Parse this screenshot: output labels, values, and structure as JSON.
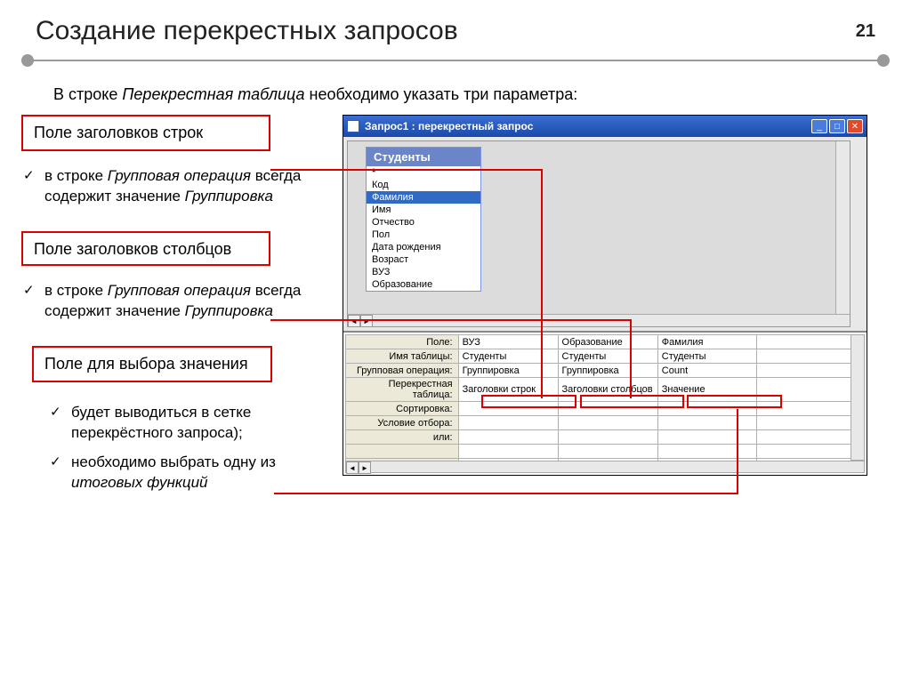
{
  "slide": {
    "title": "Создание перекрестных запросов",
    "number": "21"
  },
  "intro": {
    "prefix": "В строке ",
    "em": "Перекрестная таблица",
    "suffix": " необходимо указать три параметра:"
  },
  "labels": {
    "rowHeaders": "Поле заголовков строк",
    "colHeaders": "Поле заголовков столбцов",
    "valueField": "Поле для выбора значения"
  },
  "bullets": {
    "b1_prefix": "в строке ",
    "b1_em": "Групповая операция",
    "b1_mid": " всегда содержит значение ",
    "b1_em2": "Группировка",
    "b2_prefix": "в строке ",
    "b2_em": "Групповая операция",
    "b2_mid": " всегда содержит значение ",
    "b2_em2": "Группировка",
    "b3": "будет выводиться в сетке перекрёстного запроса);",
    "b4_prefix": "необходимо выбрать одну из ",
    "b4_em": "итоговых функций"
  },
  "window": {
    "title": "Запрос1 : перекрестный запрос",
    "tableName": "Студенты",
    "fields": [
      "Код",
      "Фамилия",
      "Имя",
      "Отчество",
      "Пол",
      "Дата рождения",
      "Возраст",
      "ВУЗ",
      "Образование"
    ],
    "selectedField": "Фамилия"
  },
  "grid": {
    "rows": {
      "field": "Поле:",
      "table": "Имя таблицы:",
      "groupOp": "Групповая операция:",
      "crosstab": "Перекрестная таблица:",
      "sort": "Сортировка:",
      "criteria": "Условие отбора:",
      "or": "или:"
    },
    "cols": [
      {
        "field": "ВУЗ",
        "table": "Студенты",
        "groupOp": "Группировка",
        "crosstab": "Заголовки строк"
      },
      {
        "field": "Образование",
        "table": "Студенты",
        "groupOp": "Группировка",
        "crosstab": "Заголовки столбцов"
      },
      {
        "field": "Фамилия",
        "table": "Студенты",
        "groupOp": "Count",
        "crosstab": "Значение"
      }
    ]
  }
}
